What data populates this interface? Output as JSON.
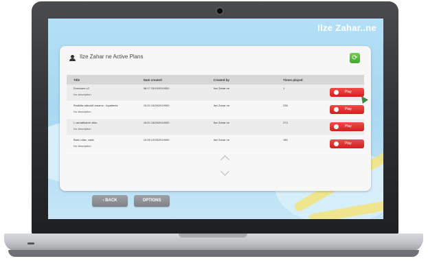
{
  "app": {
    "brand": "Ilze Zahar..ne",
    "panel_title": "Ilze Zahar   ne Active Plans",
    "refresh_icon": "refresh-icon"
  },
  "table": {
    "headers": [
      "Title",
      "Date created",
      "Created by",
      "Times played",
      ""
    ],
    "rows": [
      {
        "title": "Exercises v2",
        "subtitle": "No description",
        "date": "08:17 03/10/2019000",
        "created_by": "Ilze Zahar    ne",
        "times": "1",
        "action": "Play"
      },
      {
        "title": "Realitās stāvoklī-zarams - Inpatients",
        "subtitle": "No description",
        "date": "15:20 15/09/2019000",
        "created_by": "Ilze Zahar    ne",
        "times": "235",
        "action": "Play"
      },
      {
        "title": "L usmathlame ollav",
        "subtitle": "No description",
        "date": "15:20 15/05/2019000",
        "created_by": "Ilze Zahar    ne",
        "times": "273",
        "action": "Play"
      },
      {
        "title": "Bartu ollav, vairā",
        "subtitle": "No description",
        "date": "10:28 12/05/2019000",
        "created_by": "Ilze Zahar    ne",
        "times": "180",
        "action": "Play"
      }
    ]
  },
  "footer": {
    "back_label": "‹ BACK",
    "options_label": "OPTIONS"
  },
  "colors": {
    "play": "#e02a2a",
    "refresh": "#4cb834",
    "sky": "#b3dff6",
    "footer_button": "#8c8f94"
  }
}
